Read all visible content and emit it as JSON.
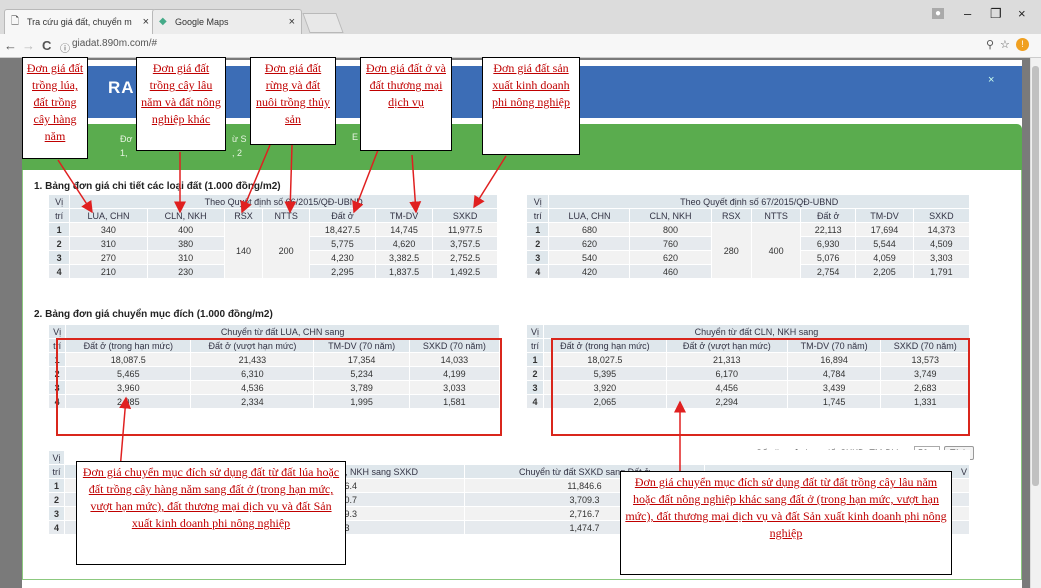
{
  "browser": {
    "tabs": [
      {
        "label": "Tra cứu giá đất, chuyển m"
      },
      {
        "label": "Google Maps"
      }
    ],
    "url": "giadat.890m.com/#",
    "close_glyph": "×",
    "win_min": "–",
    "win_max": "❐",
    "win_close": "×",
    "back": "←",
    "forward": "→",
    "reload": "C",
    "info": "ⓘ",
    "zoom": "⚲",
    "star": "☆",
    "alert": "!"
  },
  "modal": {
    "title_partial": "RA",
    "green_line1": "Đơ",
    "green_line2": "1,",
    "green_frag1": "ừ S",
    "green_frag2": ", 2",
    "green_frag3": "E"
  },
  "section1": {
    "heading": "1. Bảng đơn giá chi tiết các loại đất (1.000 đồng/m2)",
    "vi": "Vị",
    "tri": "trí",
    "group_header": "Theo Quyết định số 66/2015/QĐ-UBND",
    "cols": [
      "LUA, CHN",
      "CLN, NKH",
      "RSX",
      "NTTS",
      "Đất ở",
      "TM-DV",
      "SXKD"
    ],
    "left": {
      "rows": [
        [
          "1",
          "340",
          "400",
          "",
          "",
          "18,427.5",
          "14,745",
          "11,977.5"
        ],
        [
          "2",
          "310",
          "380",
          "",
          "",
          "5,775",
          "4,620",
          "3,757.5"
        ],
        [
          "3",
          "270",
          "310",
          "",
          "",
          "4,230",
          "3,382.5",
          "2,752.5"
        ],
        [
          "4",
          "210",
          "230",
          "",
          "",
          "2,295",
          "1,837.5",
          "1,492.5"
        ]
      ],
      "rsx": "140",
      "ntts": "200"
    },
    "right": {
      "group_header": "Theo Quyết định số 67/2015/QĐ-UBND",
      "rows": [
        [
          "1",
          "680",
          "800",
          "",
          "",
          "22,113",
          "17,694",
          "14,373"
        ],
        [
          "2",
          "620",
          "760",
          "",
          "",
          "6,930",
          "5,544",
          "4,509"
        ],
        [
          "3",
          "540",
          "620",
          "",
          "",
          "5,076",
          "4,059",
          "3,303"
        ],
        [
          "4",
          "420",
          "460",
          "",
          "",
          "2,754",
          "2,205",
          "1,791"
        ]
      ],
      "rsx": "280",
      "ntts": "400"
    }
  },
  "section2": {
    "heading": "2. Bảng đơn giá chuyển mục đích (1.000 đồng/m2)",
    "left_group": "Chuyển từ đất LUA, CHN sang",
    "right_group": "Chuyển từ đất CLN, NKH sang",
    "cols": [
      "Đất ở (trong hạn mức)",
      "Đất ở (vượt hạn mức)",
      "TM-DV (70 năm)",
      "SXKD (70 năm)"
    ],
    "left": [
      [
        "1",
        "18,087.5",
        "21,433",
        "17,354",
        "14,033"
      ],
      [
        "2",
        "5,465",
        "6,310",
        "5,234",
        "4,199"
      ],
      [
        "3",
        "3,960",
        "4,536",
        "3,789",
        "3,033"
      ],
      [
        "4",
        "2,085",
        "2,334",
        "1,995",
        "1,581"
      ]
    ],
    "right": [
      [
        "1",
        "18,027.5",
        "21,313",
        "16,894",
        "13,573"
      ],
      [
        "2",
        "5,395",
        "6,170",
        "4,784",
        "3,749"
      ],
      [
        "3",
        "3,920",
        "4,456",
        "3,439",
        "2,683"
      ],
      [
        "4",
        "2,065",
        "2,294",
        "1,745",
        "1,331"
      ]
    ]
  },
  "section3": {
    "years_label": "Số năm sử dụng đất SXKD, TM-DV:",
    "years_value": "50",
    "calc_button": "Tính",
    "col_partial_a": "CLN, NKH sang SXKD",
    "col_b": "Chuyển từ đất SXKD sang Đất ở",
    "col_c_fragment": "V",
    "rows": [
      [
        "1",
        "9,466.4",
        "11,846.6"
      ],
      [
        "2",
        "2,460.7",
        "3,709.3"
      ],
      [
        "3",
        "1,739.3",
        "2,716.7"
      ],
      [
        "4",
        "819.3",
        "1,474.7"
      ]
    ]
  },
  "notes": {
    "n1": "Đơn giá đất trồng lúa, đất trồng cây hàng năm",
    "n2": "Đơn giá đất trồng cây lâu năm và đất nông nghiệp khác",
    "n3": "Đơn giá đất rừng và đất nuôi trồng thủy sản",
    "n4": "Đơn giá đất ở và đất thương mại dịch vụ",
    "n5": "Đơn giá đất sản xuất kinh doanh phi nông nghiệp",
    "n6": "Đơn giá chuyển mục đích sử dụng đất từ đất lúa hoặc đất trồng cây hàng năm sang đất ở (trong hạn mức, vượt hạn mức), đất thương mại dịch vụ và đất Sản xuất kinh doanh phi nông nghiệp",
    "n7": "Đơn giá chuyển mục đích sử dụng đất từ đất trồng cây lâu năm hoặc đất nông nghiệp khác sang đất ở (trong hạn mức, vượt hạn mức), đất thương mại dịch vụ và đất Sản xuất kinh doanh phi nông nghiệp"
  },
  "colors": {
    "arrow": "#e02020",
    "header": "#3c6db6",
    "green": "#5aac4e"
  }
}
